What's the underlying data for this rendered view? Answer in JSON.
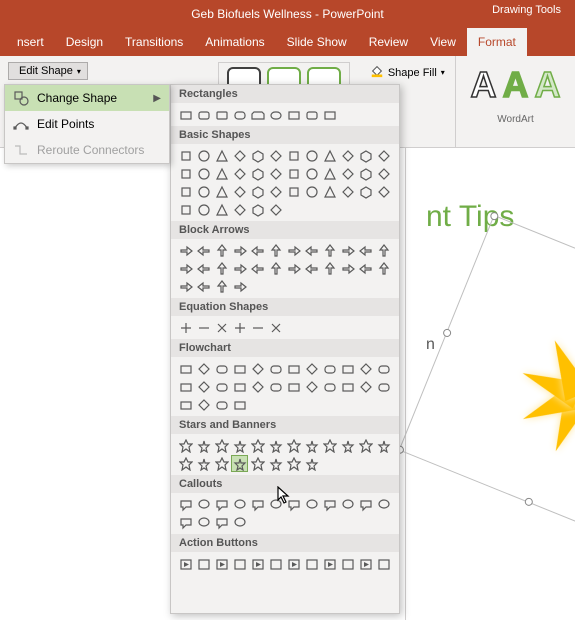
{
  "window": {
    "title": "Geb Biofuels Wellness - PowerPoint",
    "tool_context": "Drawing Tools"
  },
  "ribbon_tabs": [
    "nsert",
    "Design",
    "Transitions",
    "Animations",
    "Slide Show",
    "Review",
    "View",
    "Format"
  ],
  "active_tab_index": 7,
  "insert_shapes": {
    "edit_shape_label": "Edit Shape",
    "shape_fill_label": "Shape Fill"
  },
  "wordart": {
    "label": "WordArt"
  },
  "edit_shape_menu": {
    "change_shape": "Change Shape",
    "edit_points": "Edit Points",
    "reroute_connectors": "Reroute Connectors"
  },
  "shape_categories": [
    {
      "name": "Rectangles",
      "count": 9
    },
    {
      "name": "Basic Shapes",
      "count": 42
    },
    {
      "name": "Block Arrows",
      "count": 28
    },
    {
      "name": "Equation Shapes",
      "count": 6
    },
    {
      "name": "Flowchart",
      "count": 28
    },
    {
      "name": "Stars and Banners",
      "count": 20
    },
    {
      "name": "Callouts",
      "count": 16
    },
    {
      "name": "Action Buttons",
      "count": 12
    }
  ],
  "slide": {
    "title_fragment": "nt Tips",
    "body_fragment": "n"
  }
}
